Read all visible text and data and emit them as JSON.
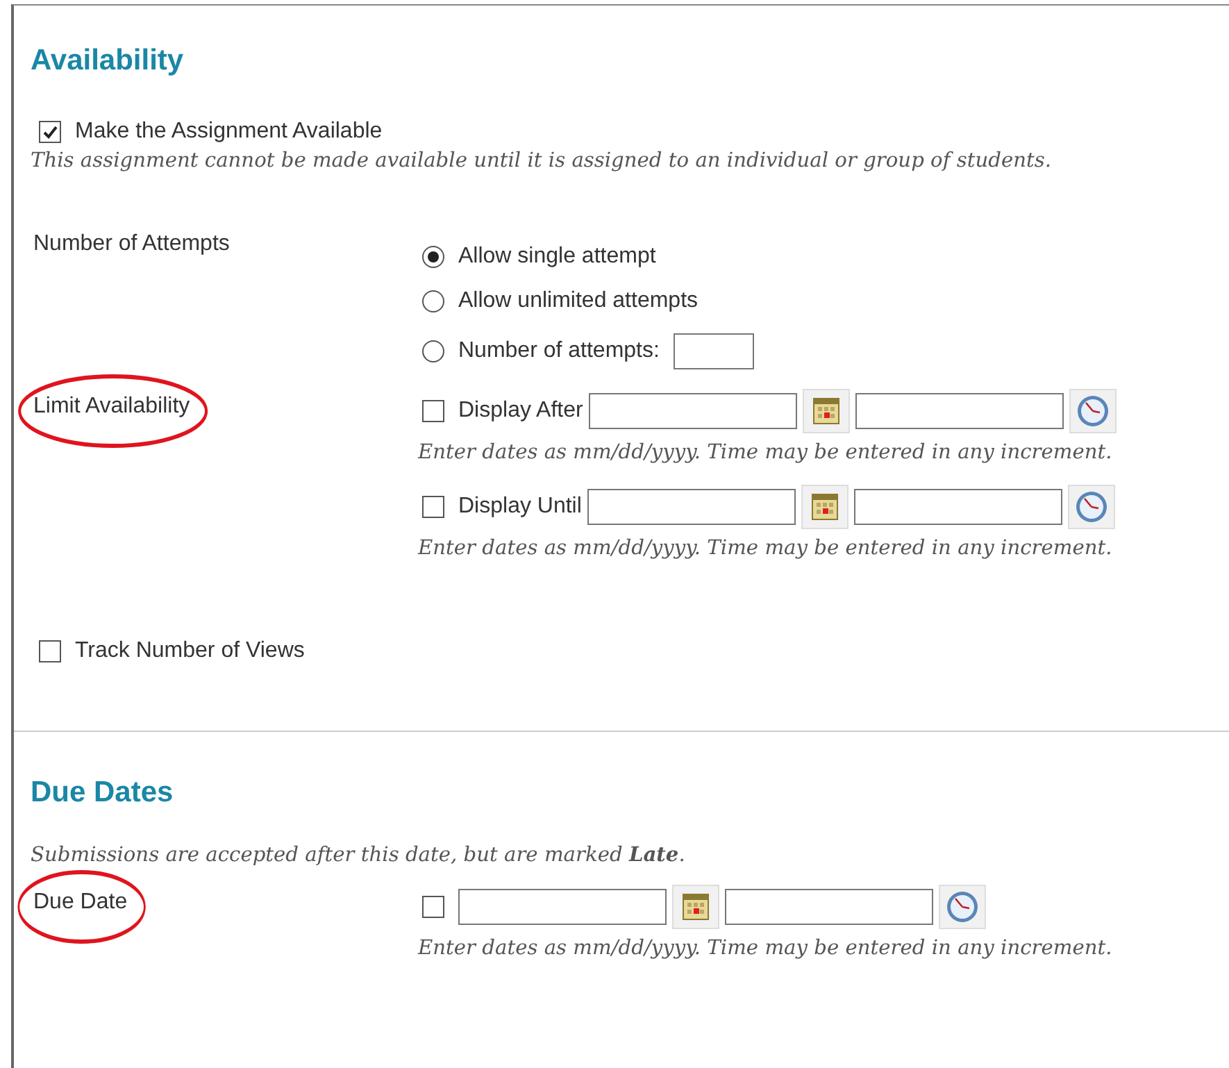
{
  "availability": {
    "title": "Availability",
    "make_available": {
      "label": "Make the Assignment Available",
      "checked": true
    },
    "note": "This assignment cannot be made available until it is assigned to an individual or group of students.",
    "attempts": {
      "label": "Number of Attempts",
      "options": [
        {
          "label": "Allow single attempt",
          "selected": true,
          "kind": "plain"
        },
        {
          "label": "Allow unlimited attempts",
          "selected": false,
          "kind": "plain"
        },
        {
          "label": "Number of attempts:",
          "selected": false,
          "kind": "count"
        }
      ]
    },
    "limit": {
      "label": "Limit Availability",
      "circled": true,
      "rows": [
        {
          "label": "Display After",
          "checked": false,
          "hint": "Enter dates as mm/dd/yyyy. Time may be entered in any increment."
        },
        {
          "label": "Display Until",
          "checked": false,
          "hint": "Enter dates as mm/dd/yyyy. Time may be entered in any increment."
        }
      ]
    },
    "track_views": {
      "label": "Track Number of Views",
      "checked": false
    }
  },
  "due_dates": {
    "title": "Due Dates",
    "note": "Submissions are accepted after this date, but are marked **Late**.",
    "due_date": {
      "label": "Due Date",
      "circled": true,
      "checked": false,
      "hint": "Enter dates as mm/dd/yyyy. Time may be entered in any increment."
    }
  }
}
